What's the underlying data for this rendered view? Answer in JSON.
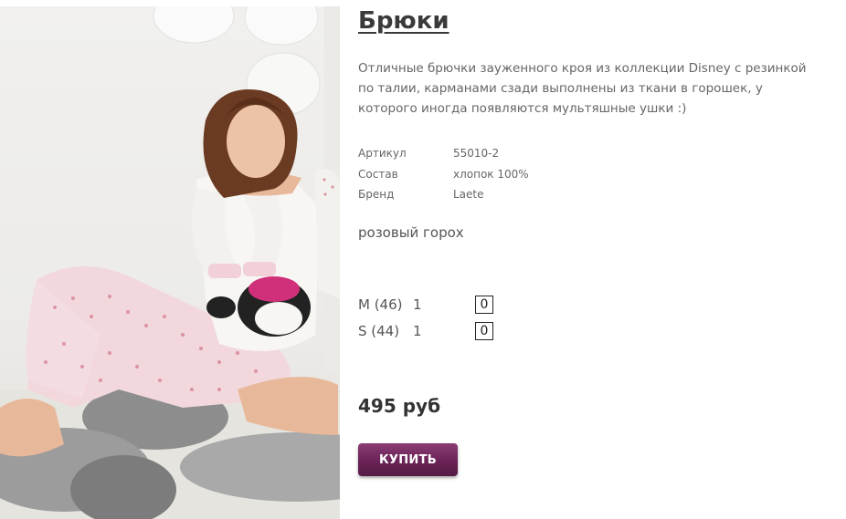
{
  "product": {
    "title": "Брюки",
    "description": "Отличные брючки зауженного кроя из коллекции Disney с резинкой по талии, карманами сзади выполнены из ткани в горошек, у которого иногда появляются мультяшные ушки :)",
    "specs": [
      {
        "key": "Артикул",
        "value": "55010-2"
      },
      {
        "key": "Состав",
        "value": "хлопок 100%"
      },
      {
        "key": "Бренд",
        "value": "Laete"
      }
    ],
    "color": "розовый горох",
    "sizes": [
      {
        "label": "M (46)",
        "stock": "1",
        "qty": "0"
      },
      {
        "label": "S (44)",
        "stock": "1",
        "qty": "0"
      }
    ],
    "price": "495 руб",
    "buy_label": "КУПИТЬ"
  },
  "colors": {
    "button": "#6a2356",
    "text": "#555555"
  }
}
